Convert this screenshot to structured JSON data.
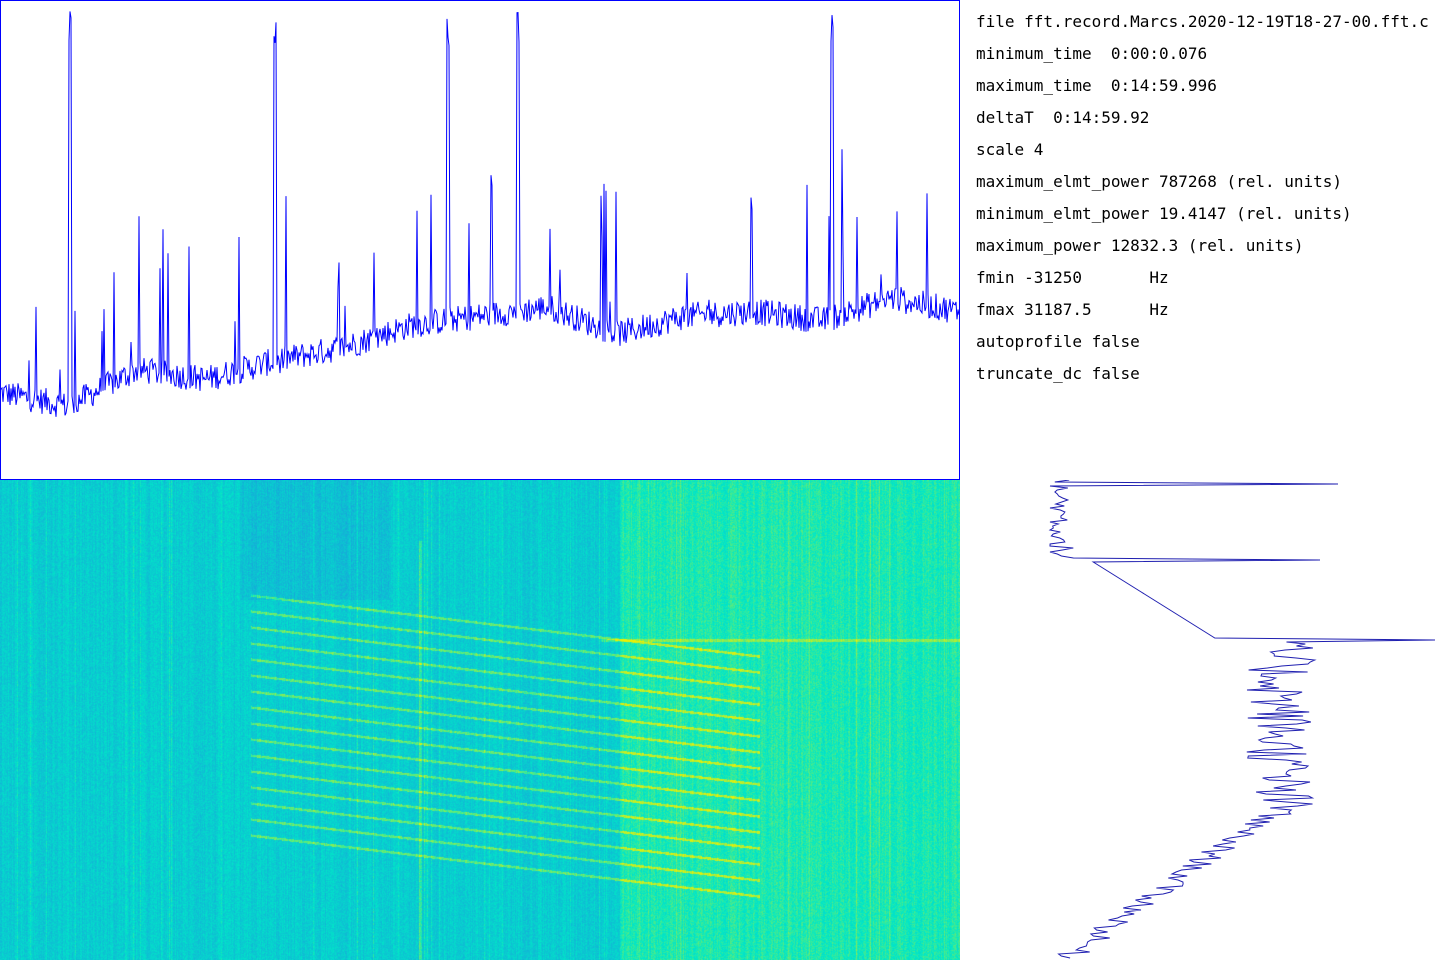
{
  "info": {
    "file": "file fft.record.Marcs.2020-12-19T18-27-00.fft.c",
    "minimum_time": "minimum_time  0:00:0.076",
    "maximum_time": "maximum_time  0:14:59.996",
    "deltaT": "deltaT  0:14:59.92",
    "scale": "scale 4",
    "maximum_elmt_power": "maximum_elmt_power 787268 (rel. units)",
    "minimum_elmt_power": "minimum_elmt_power 19.4147 (rel. units)",
    "maximum_power": "maximum_power 12832.3 (rel. units)",
    "fmin": "fmin -31250       Hz",
    "fmax": "fmax 31187.5      Hz",
    "autoprofile": "autoprofile false",
    "truncate_dc": "truncate_dc false"
  },
  "colors": {
    "trace": "#0000ff",
    "frame": "#0000ff",
    "spectrogram_low": "#1f8fe0",
    "spectrogram_mid": "#00e8c8",
    "spectrogram_high": "#f0f000",
    "profile_line": "#1f1fb0"
  },
  "chart_data": [
    {
      "type": "line",
      "description_role": "time-profile",
      "x_range_seconds": [
        0.076,
        899.996
      ],
      "approx_level_by_minute": [
        0.15,
        0.12,
        0.2,
        0.18,
        0.22,
        0.25,
        0.3,
        0.32,
        0.34,
        0.28,
        0.32,
        0.33,
        0.31,
        0.36,
        0.33
      ],
      "peaks_minute": [
        1.1,
        4.3,
        7.0,
        8.1,
        13.0
      ]
    },
    {
      "type": "heatmap",
      "description_role": "spectrogram",
      "x_range_seconds": [
        0.076,
        899.996
      ],
      "y_range_hz": [
        -31250,
        31187.5
      ]
    },
    {
      "type": "line",
      "description_role": "frequency-profile",
      "y_range_hz": [
        -31250,
        31187.5
      ]
    }
  ]
}
